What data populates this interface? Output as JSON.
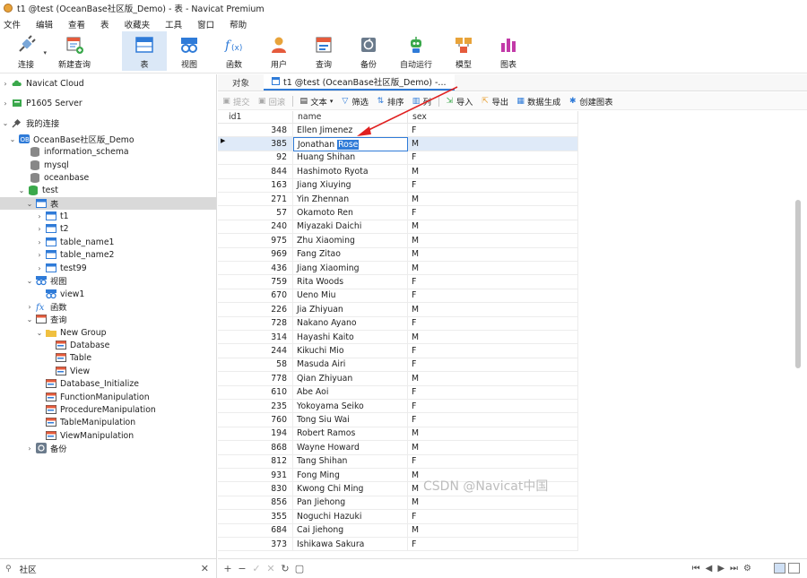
{
  "window": {
    "title": "t1 @test (OceanBase社区版_Demo) - 表 - Navicat Premium"
  },
  "menu": [
    "文件",
    "编辑",
    "查看",
    "表",
    "收藏夹",
    "工具",
    "窗口",
    "帮助"
  ],
  "toolbar": {
    "connect": "连接",
    "new_query": "新建查询",
    "table": "表",
    "view": "视图",
    "function": "函数",
    "user": "用户",
    "query": "查询",
    "backup": "备份",
    "automation": "自动运行",
    "model": "模型",
    "chart": "图表"
  },
  "sidebar": {
    "navicat_cloud": "Navicat Cloud",
    "p1605": "P1605 Server",
    "my_connections": "我的连接",
    "conn": "OceanBase社区版_Demo",
    "db_info": "information_schema",
    "db_mysql": "mysql",
    "db_oceanbase": "oceanbase",
    "db_test": "test",
    "tables_group": "表",
    "tables": [
      "t1",
      "t2",
      "table_name1",
      "table_name2",
      "test99"
    ],
    "views_group": "视图",
    "view1": "view1",
    "functions_group": "函数",
    "queries_group": "查询",
    "new_group": "New Group",
    "group_items": [
      "Database",
      "Table",
      "View"
    ],
    "queries": [
      "Database_Initialize",
      "FunctionManipulation",
      "ProcedureManipulation",
      "TableManipulation",
      "ViewManipulation"
    ],
    "backup_group": "备份",
    "community": "社区"
  },
  "tabs": {
    "objects": "对象",
    "active": "t1 @test (OceanBase社区版_Demo) -..."
  },
  "data_toolbar": {
    "commit": "提交",
    "rollback": "回滚",
    "text": "文本",
    "filter": "筛选",
    "sort": "排序",
    "columns": "列",
    "import": "导入",
    "export": "导出",
    "data_gen": "数据生成",
    "create_chart": "创建图表"
  },
  "grid": {
    "columns": [
      "id1",
      "name",
      "sex"
    ],
    "editing_prefix": "Jonathan ",
    "editing_selected": "Rose",
    "rows": [
      [
        "348",
        "Ellen Jimenez",
        "F"
      ],
      [
        "385",
        "Jonathan Rose",
        "M"
      ],
      [
        "92",
        "Huang Shihan",
        "F"
      ],
      [
        "844",
        "Hashimoto Ryota",
        "M"
      ],
      [
        "163",
        "Jiang Xiuying",
        "F"
      ],
      [
        "271",
        "Yin Zhennan",
        "M"
      ],
      [
        "57",
        "Okamoto Ren",
        "F"
      ],
      [
        "240",
        "Miyazaki Daichi",
        "M"
      ],
      [
        "975",
        "Zhu Xiaoming",
        "M"
      ],
      [
        "969",
        "Fang Zitao",
        "M"
      ],
      [
        "436",
        "Jiang Xiaoming",
        "M"
      ],
      [
        "759",
        "Rita Woods",
        "F"
      ],
      [
        "670",
        "Ueno Miu",
        "F"
      ],
      [
        "226",
        "Jia Zhiyuan",
        "M"
      ],
      [
        "728",
        "Nakano Ayano",
        "F"
      ],
      [
        "314",
        "Hayashi Kaito",
        "M"
      ],
      [
        "244",
        "Kikuchi Mio",
        "F"
      ],
      [
        "58",
        "Masuda Airi",
        "F"
      ],
      [
        "778",
        "Qian Zhiyuan",
        "M"
      ],
      [
        "610",
        "Abe Aoi",
        "F"
      ],
      [
        "235",
        "Yokoyama Seiko",
        "F"
      ],
      [
        "760",
        "Tong Siu Wai",
        "F"
      ],
      [
        "194",
        "Robert Ramos",
        "M"
      ],
      [
        "868",
        "Wayne Howard",
        "M"
      ],
      [
        "812",
        "Tang Shihan",
        "F"
      ],
      [
        "931",
        "Fong Ming",
        "M"
      ],
      [
        "830",
        "Kwong Chi Ming",
        "M"
      ],
      [
        "856",
        "Pan Jiehong",
        "M"
      ],
      [
        "355",
        "Noguchi Hazuki",
        "F"
      ],
      [
        "684",
        "Cai Jiehong",
        "M"
      ],
      [
        "373",
        "Ishikawa Sakura",
        "F"
      ]
    ]
  },
  "watermark": "CSDN @Navicat中国"
}
